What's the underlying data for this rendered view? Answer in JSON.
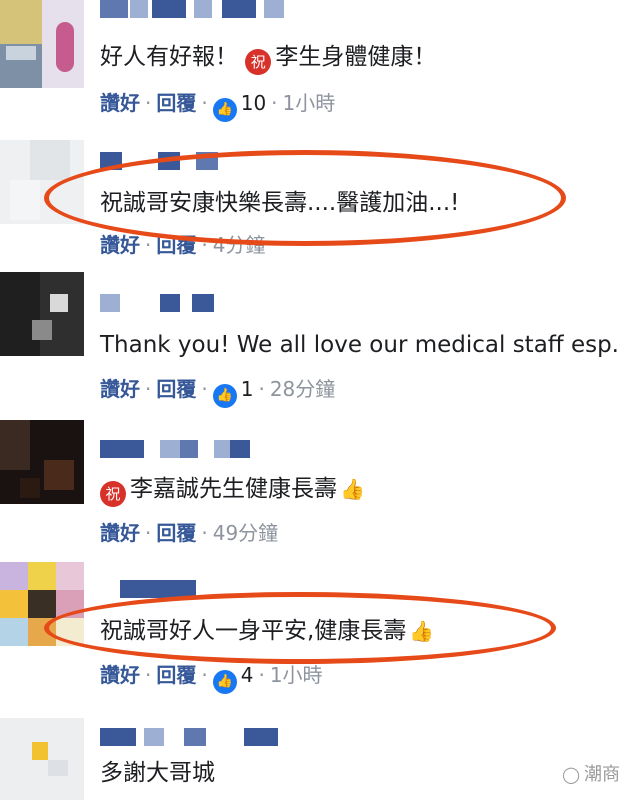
{
  "colors": {
    "link": "#365899",
    "meta": "#8d949e",
    "like_blue": "#1877f2",
    "highlight_ellipse": "#e64a19",
    "badge_red": "#d8312a"
  },
  "comments": [
    {
      "text": "好人有好報！ ",
      "badge": "祝",
      "text_after": "李生身體健康！",
      "actions": {
        "like": "讚好",
        "reply": "回覆",
        "like_count": "10",
        "time": "1小時"
      }
    },
    {
      "text": "祝誠哥安康快樂長壽....醫護加油...!",
      "actions": {
        "like": "讚好",
        "reply": "回覆",
        "time": "4分鐘"
      }
    },
    {
      "text": "Thank you! We all love our medical staff esp.",
      "actions": {
        "like": "讚好",
        "reply": "回覆",
        "like_count": "1",
        "time": "28分鐘"
      }
    },
    {
      "badge": "祝",
      "text": "李嘉誠先生健康長壽",
      "emoji": "thumbs-up",
      "actions": {
        "like": "讚好",
        "reply": "回覆",
        "time": "49分鐘"
      }
    },
    {
      "text": "祝誠哥好人一身平安,健康長壽",
      "emoji": "thumbs-up",
      "actions": {
        "like": "讚好",
        "reply": "回覆",
        "like_count": "4",
        "time": "1小時"
      }
    },
    {
      "text": "多謝大哥城"
    }
  ],
  "icons": {
    "like": "thumbs-up-icon",
    "wechat": "wechat-icon"
  },
  "watermark": {
    "text": "潮商"
  }
}
